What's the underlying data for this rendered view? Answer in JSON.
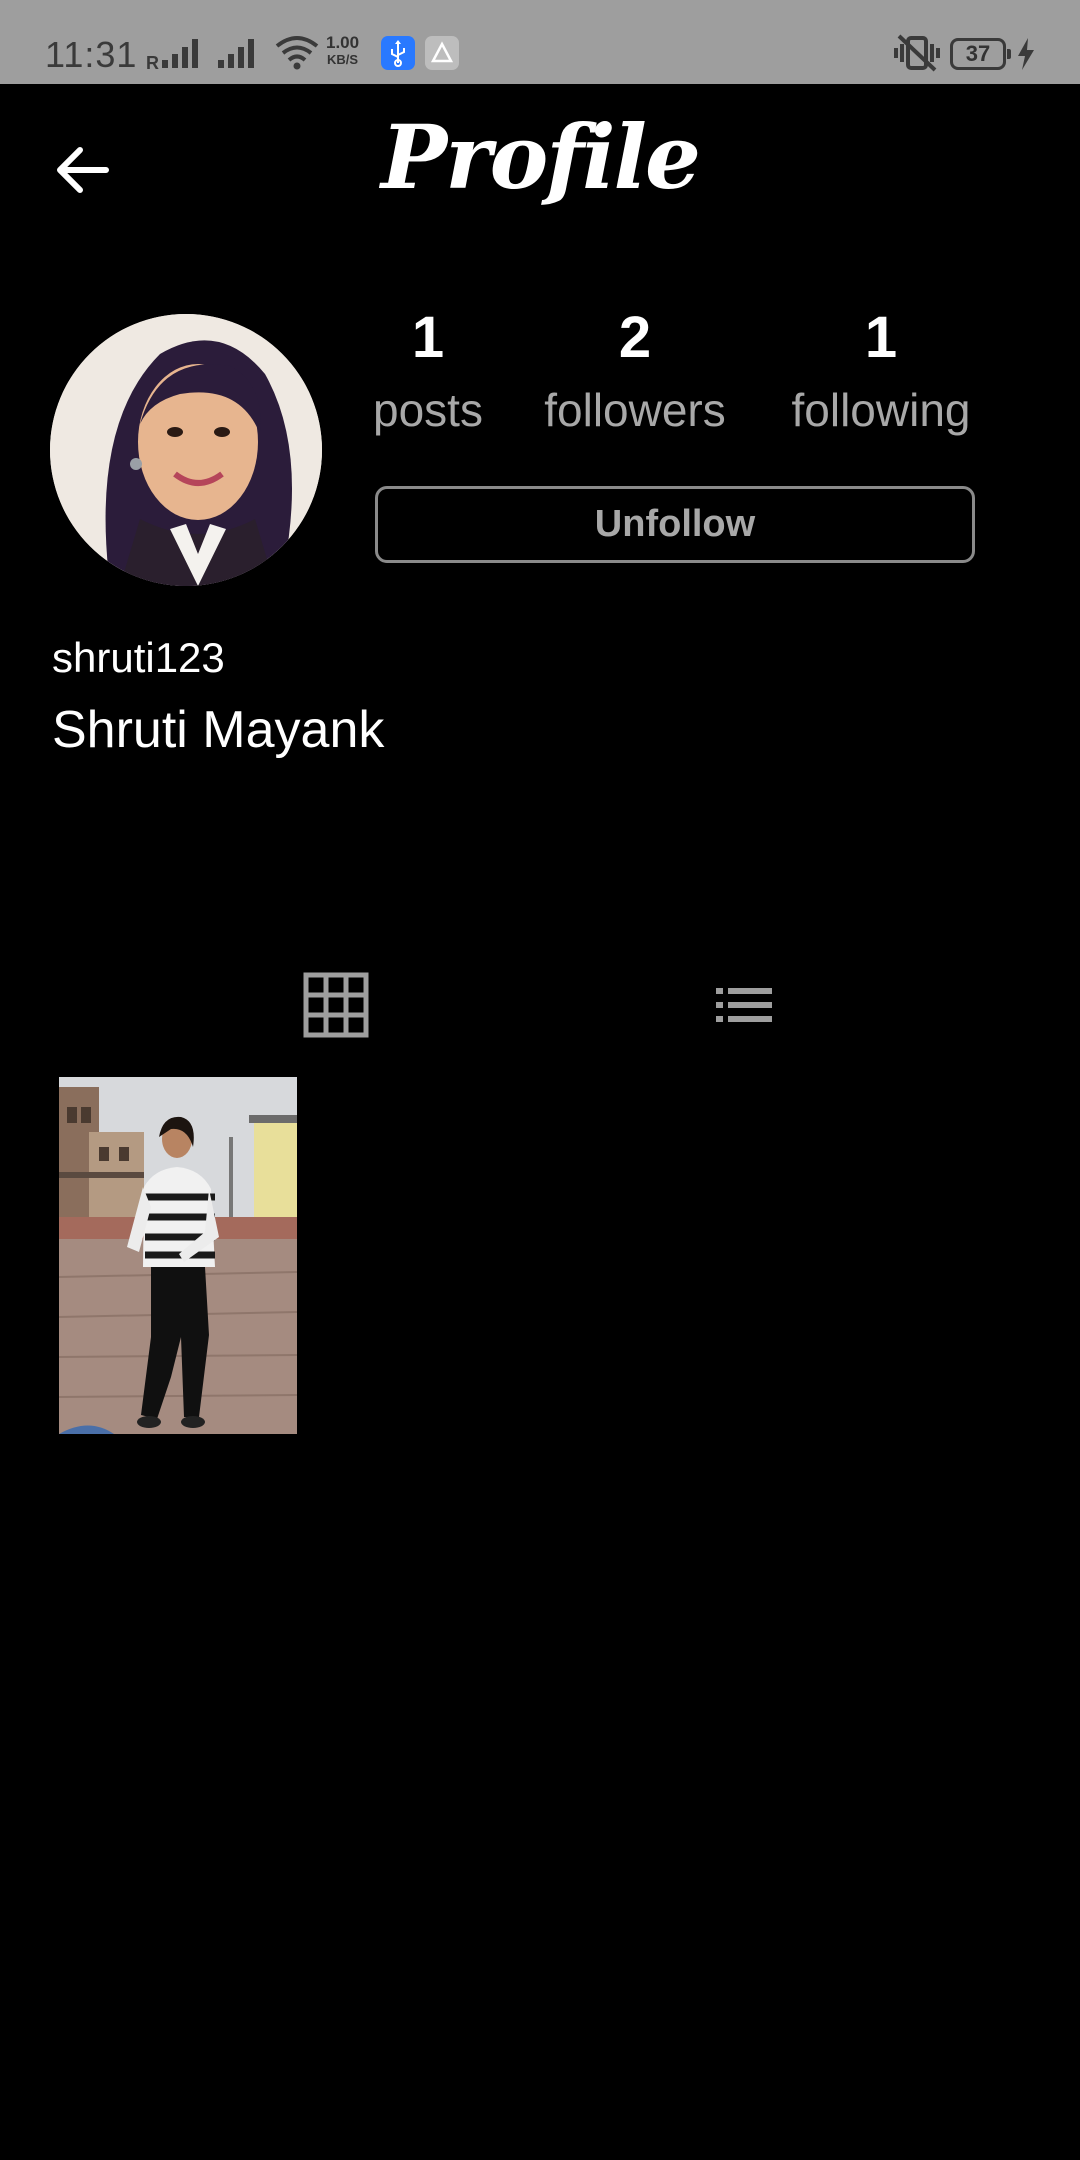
{
  "status_bar": {
    "time": "11:31",
    "network_speed_top": "1.00",
    "network_speed_unit": "KB/S",
    "battery_level": "37"
  },
  "header": {
    "title": "Profile"
  },
  "profile": {
    "username": "shruti123",
    "full_name": "Shruti Mayank",
    "stats": {
      "posts_count": "1",
      "posts_label": "posts",
      "followers_count": "2",
      "followers_label": "followers",
      "following_count": "1",
      "following_label": "following"
    },
    "action_button_label": "Unfollow"
  },
  "tabs": [
    {
      "icon": "grid-icon",
      "active": true
    },
    {
      "icon": "list-icon",
      "active": false
    }
  ],
  "colors": {
    "background": "#000000",
    "status_bar": "#9e9e9e",
    "muted_text": "#a8a8a8",
    "usb_badge": "#2979ff"
  }
}
